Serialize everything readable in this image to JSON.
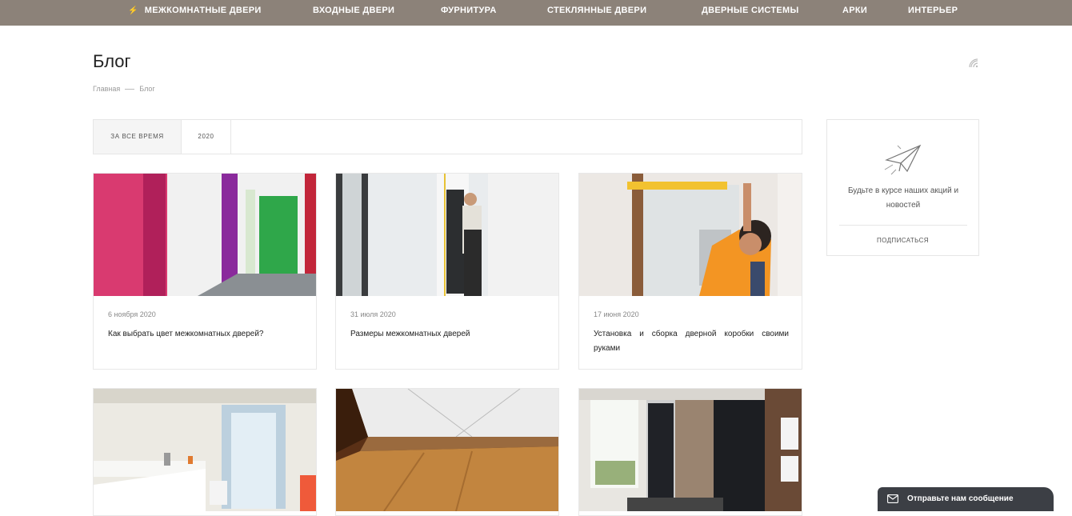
{
  "nav": {
    "items": [
      {
        "label": "МЕЖКОМНАТНЫЕ ДВЕРИ"
      },
      {
        "label": "ВХОДНЫЕ ДВЕРИ"
      },
      {
        "label": "ФУРНИТУРА"
      },
      {
        "label": "СТЕКЛЯННЫЕ ДВЕРИ"
      },
      {
        "label": "ДВЕРНЫЕ СИСТЕМЫ"
      },
      {
        "label": "АРКИ"
      },
      {
        "label": "ИНТЕРЬЕР"
      }
    ],
    "bolt_icon": "lightning-icon"
  },
  "page": {
    "title": "Блог",
    "breadcrumbs": [
      "Главная",
      "Блог"
    ]
  },
  "filter": {
    "tabs": [
      {
        "label": "ЗА ВСЕ ВРЕМЯ"
      },
      {
        "label": "2020"
      }
    ]
  },
  "posts": [
    {
      "date": "6 ноября 2020",
      "title": "Как выбрать цвет межкомнатных дверей?"
    },
    {
      "date": "31 июля 2020",
      "title": "Размеры межкомнатных дверей"
    },
    {
      "date": "17 июня 2020",
      "title": "Установка и сборка дверной коробки своими руками"
    },
    {
      "date": "",
      "title": ""
    },
    {
      "date": "",
      "title": ""
    },
    {
      "date": "",
      "title": ""
    }
  ],
  "subscribe": {
    "text": "Будьте в курсе наших акций и новостей",
    "button": "ПОДПИСАТЬСЯ",
    "icon": "paper-plane-icon"
  },
  "chat": {
    "label": "Отправьте нам сообщение",
    "icon": "mail-icon"
  },
  "colors": {
    "nav_bg": "#8c8279",
    "chat_bg": "#3c3f45"
  }
}
